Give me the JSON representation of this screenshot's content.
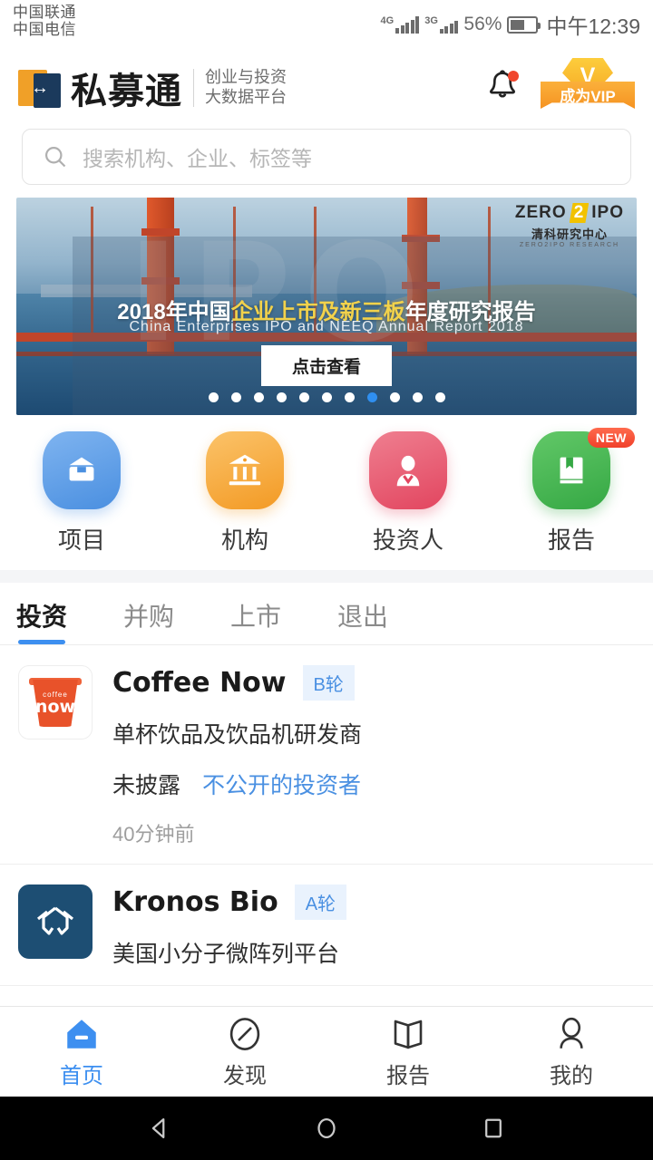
{
  "status_bar": {
    "carrier_1": "中国联通",
    "carrier_2": "中国电信",
    "network_1": "4G",
    "network_2": "3G",
    "battery_percent": "56%",
    "time": "中午12:39"
  },
  "header": {
    "logo_text": "私募通",
    "tagline_line1": "创业与投资",
    "tagline_line2": "大数据平台",
    "vip_label": "成为VIP",
    "bell_icon": "bell-icon",
    "notification_dot": true
  },
  "search": {
    "placeholder": "搜索机构、企业、标签等",
    "icon": "search-icon"
  },
  "banner": {
    "title_part1": "2018年中国",
    "title_highlight": "企业上市及新三板",
    "title_part2": "年度研究报告",
    "subtitle": "China Enterprises IPO and NEEQ Annual Report 2018",
    "button_label": "点击查看",
    "watermark": "IPO",
    "brand_line1_a": "ZERO",
    "brand_line1_b": "2",
    "brand_line1_c": "IPO",
    "brand_line2": "清科研究中心",
    "brand_line3": "ZERO2IPO RESEARCH",
    "dots_total": 11,
    "dots_active_index": 7
  },
  "quick_actions": [
    {
      "label": "项目",
      "icon": "box-icon",
      "color": "#4a8fe0",
      "badge": ""
    },
    {
      "label": "机构",
      "icon": "bank-icon",
      "color": "#f39a24",
      "badge": ""
    },
    {
      "label": "投资人",
      "icon": "person-icon",
      "color": "#e2455f",
      "badge": ""
    },
    {
      "label": "报告",
      "icon": "book-icon",
      "color": "#35a844",
      "badge": "NEW"
    }
  ],
  "tabs": [
    {
      "label": "投资",
      "active": true
    },
    {
      "label": "并购",
      "active": false
    },
    {
      "label": "上市",
      "active": false
    },
    {
      "label": "退出",
      "active": false
    }
  ],
  "list": [
    {
      "logo": "coffee-now-logo",
      "logo_text_small": "coffee",
      "logo_text_main": "now",
      "name": "Coffee Now",
      "round": "B轮",
      "description": "单杯饮品及饮品机研发商",
      "amount": "未披露",
      "investor": "不公开的投资者",
      "time": "40分钟前"
    },
    {
      "logo": "kronos-bio-logo",
      "name": "Kronos Bio",
      "round": "A轮",
      "description": "美国小分子微阵列平台",
      "amount": "",
      "investor": "",
      "time": ""
    }
  ],
  "bottom_nav": [
    {
      "label": "首页",
      "icon": "home-icon",
      "active": true
    },
    {
      "label": "发现",
      "icon": "compass-icon",
      "active": false
    },
    {
      "label": "报告",
      "icon": "book-open-icon",
      "active": false
    },
    {
      "label": "我的",
      "icon": "user-icon",
      "active": false
    }
  ],
  "android_nav": [
    {
      "icon": "back-triangle-icon"
    },
    {
      "icon": "home-circle-icon"
    },
    {
      "icon": "recents-square-icon"
    }
  ],
  "colors": {
    "accent_blue": "#3d8ff0",
    "vip_orange": "#f5a623",
    "badge_red": "#f0402a"
  }
}
